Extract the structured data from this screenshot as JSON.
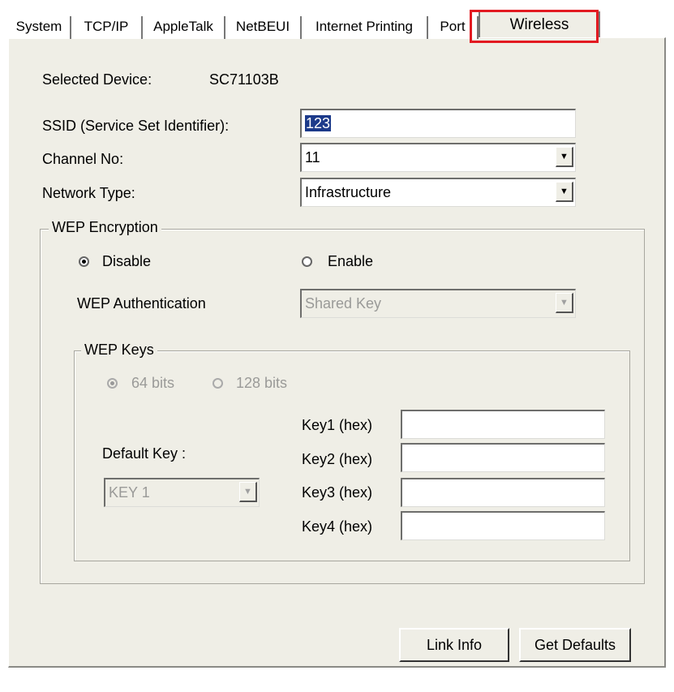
{
  "tabs": [
    {
      "label": "System"
    },
    {
      "label": "TCP/IP"
    },
    {
      "label": "AppleTalk"
    },
    {
      "label": "NetBEUI"
    },
    {
      "label": "Internet Printing"
    },
    {
      "label": "Port"
    },
    {
      "label": "Wireless"
    }
  ],
  "active_tab": "Wireless",
  "highlight_color": "#e21a21",
  "device": {
    "label": "Selected Device:",
    "value": "SC71103B"
  },
  "ssid": {
    "label": "SSID (Service Set Identifier):",
    "value": "123"
  },
  "channel": {
    "label": "Channel No:",
    "value": "11"
  },
  "network_type": {
    "label": "Network Type:",
    "value": "Infrastructure"
  },
  "wep_encryption": {
    "legend": "WEP Encryption",
    "disable_label": "Disable",
    "enable_label": "Enable",
    "selected": "Disable",
    "auth_label": "WEP Authentication",
    "auth_value": "Shared Key"
  },
  "wep_keys": {
    "legend": "WEP Keys",
    "bits64_label": "64 bits",
    "bits128_label": "128 bits",
    "selected_bits": "64 bits",
    "default_key_label": "Default Key :",
    "default_key_value": "KEY 1",
    "key_labels": [
      "Key1 (hex)",
      "Key2 (hex)",
      "Key3 (hex)",
      "Key4 (hex)"
    ],
    "key_values": [
      "",
      "",
      "",
      ""
    ]
  },
  "buttons": {
    "link_info": "Link Info",
    "get_defaults": "Get Defaults"
  }
}
